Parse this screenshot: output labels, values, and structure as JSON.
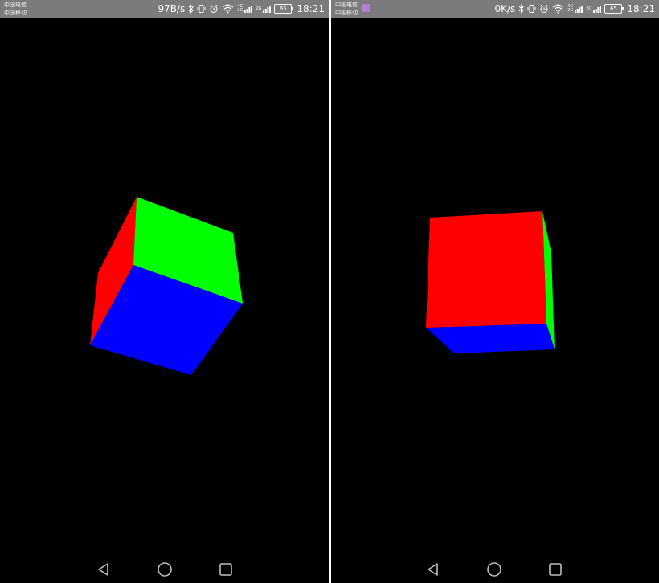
{
  "screens": [
    {
      "status": {
        "carrier_1": "中国电信",
        "carrier_2": "中国移动",
        "net_speed": "97B/s",
        "net_4g_top": "4G",
        "net_4g_bottom": "2G",
        "net_2g_label": "2G",
        "battery_level": "65",
        "time": "18:21"
      },
      "cube": {
        "face_colors": {
          "top": "#00ff00",
          "front": "#0000ff",
          "side": "#ff0000"
        }
      },
      "nav": {
        "back_icon": "back-triangle-icon",
        "home_icon": "home-circle-icon",
        "recents_icon": "recents-square-icon"
      }
    },
    {
      "status": {
        "carrier_1": "中国电信",
        "carrier_2": "中国移动",
        "net_speed": "0K/s",
        "net_4g_top": "4G",
        "net_4g_bottom": "2G",
        "net_2g_label": "2G",
        "battery_level": "65",
        "time": "18:21"
      },
      "cube": {
        "face_colors": {
          "front": "#ff0000",
          "bottom": "#0000ff",
          "side": "#00ff00"
        }
      },
      "nav": {
        "back_icon": "back-triangle-icon",
        "home_icon": "home-circle-icon",
        "recents_icon": "recents-square-icon"
      }
    }
  ],
  "colors": {
    "status_bar_bg": "#7b7b7b",
    "screen_bg": "#000000",
    "nav_icon": "#bdbdbd"
  }
}
